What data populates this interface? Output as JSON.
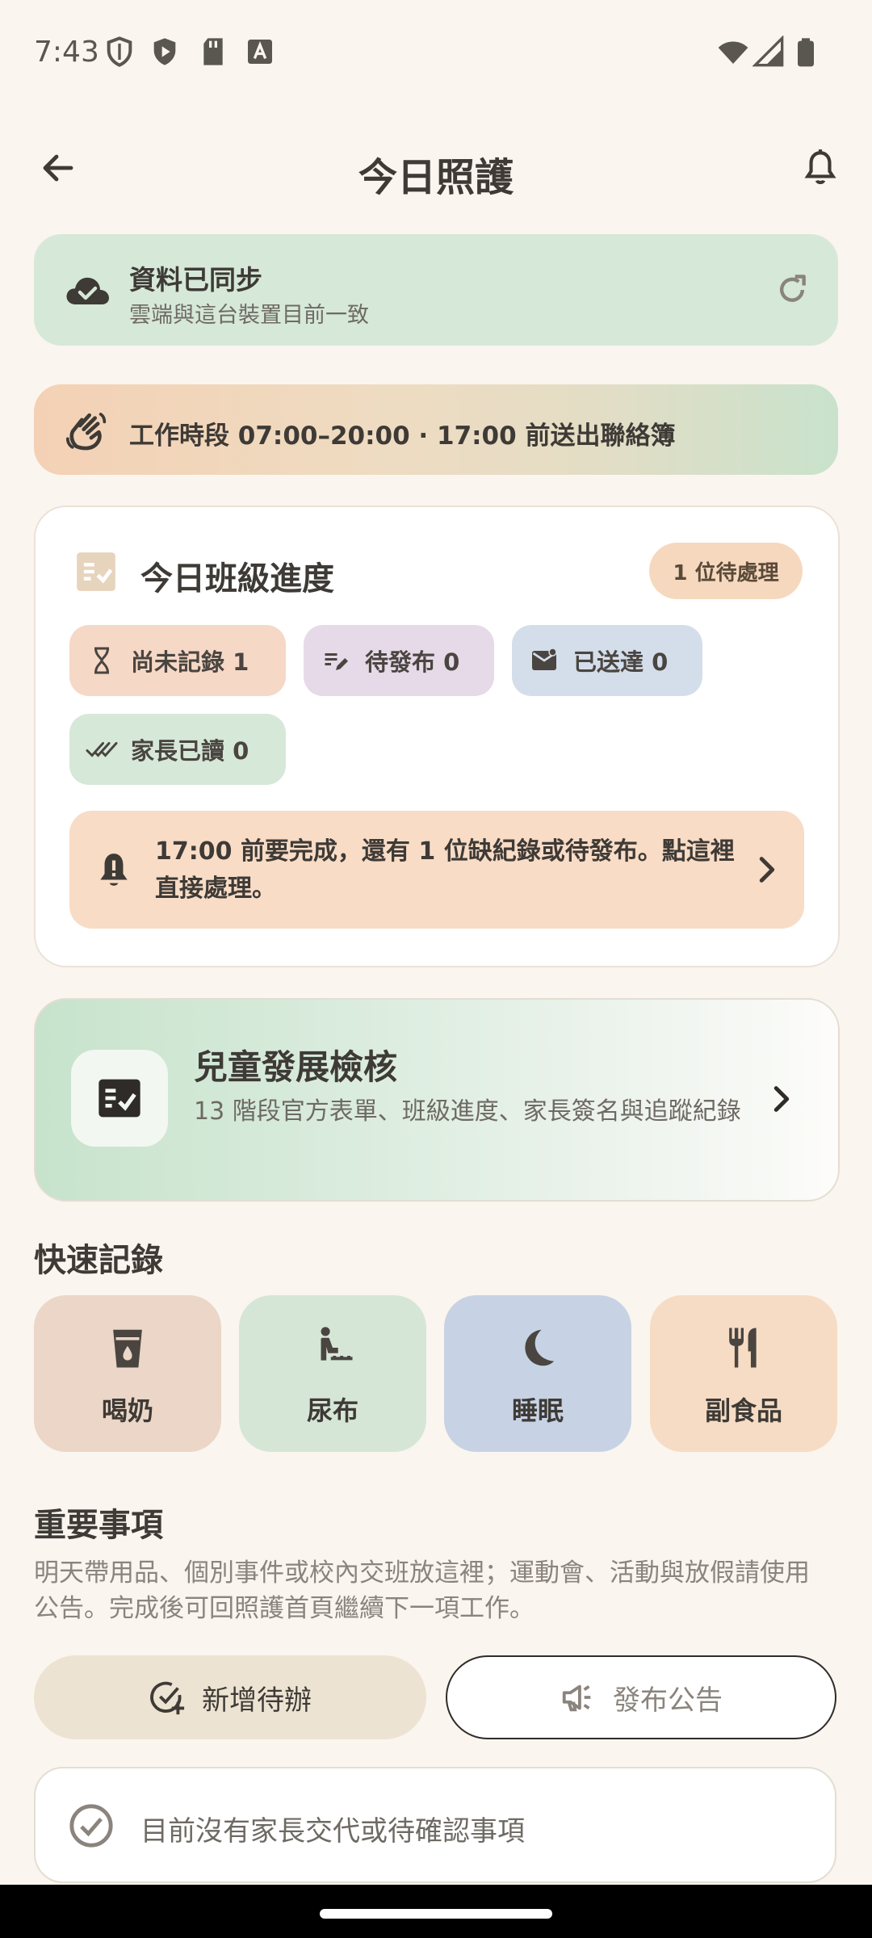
{
  "status_bar": {
    "time": "7:43",
    "icons": [
      "shield-icon",
      "play-protect-icon",
      "sd-card-icon",
      "font-icon",
      "wifi-icon",
      "signal-icon",
      "battery-icon"
    ]
  },
  "header": {
    "title": "今日照護",
    "back_icon": "arrow-left-icon",
    "bell_icon": "bell-icon"
  },
  "sync": {
    "title": "資料已同步",
    "subtitle": "雲端與這台裝置目前一致",
    "icon": "cloud-check-icon",
    "action_icon": "refresh-icon"
  },
  "hours": {
    "text": "工作時段 07:00–20:00 · 17:00 前送出聯絡簿",
    "icon": "waving-hand-icon"
  },
  "progress": {
    "title": "今日班級進度",
    "badge": "1 位待處理",
    "chips": {
      "unrecorded": "尚未記錄 1",
      "to_publish": "待發布 0",
      "sent": "已送達 0",
      "parent_read": "家長已讀 0"
    },
    "alert": "17:00 前要完成，還有 1 位缺紀錄或待發布。點這裡直接處理。"
  },
  "development": {
    "title": "兒童發展檢核",
    "subtitle": "13 階段官方表單、班級進度、家長簽名與追蹤紀錄"
  },
  "quick_record": {
    "title": "快速記錄",
    "items": [
      {
        "label": "喝奶",
        "icon": "milk-cup-icon"
      },
      {
        "label": "尿布",
        "icon": "diaper-icon"
      },
      {
        "label": "睡眠",
        "icon": "moon-icon"
      },
      {
        "label": "副食品",
        "icon": "utensils-icon"
      }
    ]
  },
  "important": {
    "title": "重要事項",
    "description": "明天帶用品、個別事件或校內交班放這裡；運動會、活動與放假請使用公告。完成後可回照護首頁繼續下一項工作。",
    "add_todo": "新增待辦",
    "publish_announcement": "發布公告",
    "empty_text": "目前沒有家長交代或待確認事項"
  },
  "colors": {
    "background": "#FAF5EF",
    "sync_green": "#D6E8D8",
    "badge_peach": "#F6D8BE",
    "text_dark": "#3E3A36"
  }
}
